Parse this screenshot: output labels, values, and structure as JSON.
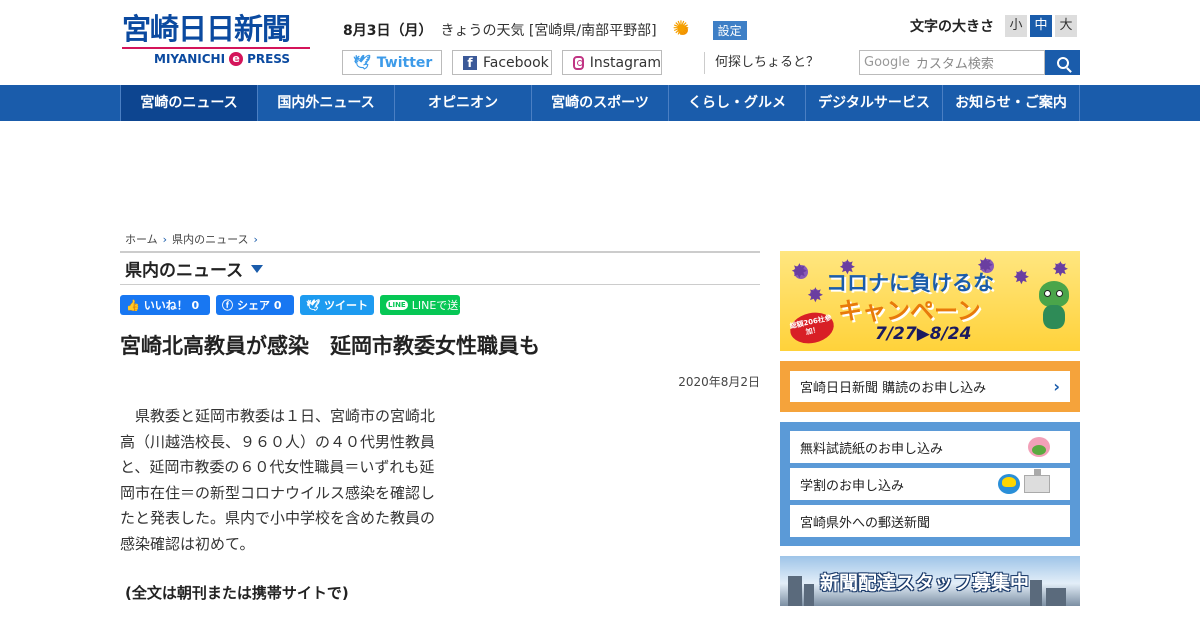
{
  "header": {
    "logo_main": "宮崎日日新聞",
    "logo_sub_left": "MIYANICHI",
    "logo_sub_e": "e",
    "logo_sub_right": "PRESS",
    "date": "8月3日（月）",
    "weather_label": "きょうの天気 [宮崎県/南部平野部]",
    "weather_icon": "sun-icon",
    "settings_label": "設定",
    "font_size_label": "文字の大きさ",
    "font_sizes": [
      "小",
      "中",
      "大"
    ],
    "font_size_selected": "中",
    "social": {
      "twitter": "Twitter",
      "facebook": "Facebook",
      "instagram": "Instagram"
    },
    "search_prompt": "何探しちょると？",
    "search_brand": "Google",
    "search_placeholder": "カスタム検索"
  },
  "nav": {
    "items": [
      "宮崎のニュース",
      "国内外ニュース",
      "オピニオン",
      "宮崎のスポーツ",
      "くらし・グルメ",
      "デジタルサービス",
      "お知らせ・ご案内"
    ],
    "active_index": 0
  },
  "breadcrumb": [
    "ホーム",
    "県内のニュース"
  ],
  "section_title": "県内のニュース",
  "share": {
    "like": "いいね！ 0",
    "share": "シェア 0",
    "tweet": "ツイート",
    "line": "LINEで送る",
    "line_badge": "LINE"
  },
  "article": {
    "title": "宮崎北高教員が感染　延岡市教委女性職員も",
    "date": "2020年8月2日",
    "body": "県教委と延岡市教委は１日、宮崎市の宮崎北高（川越浩校長、９６０人）の４０代男性教員と、延岡市教委の６０代女性職員＝いずれも延岡市在住＝の新型コロナウイルス感染を確認したと発表した。県内で小中学校を含めた教員の感染確認は初めて。",
    "note": "(全文は朝刊または携帯サイトで)"
  },
  "sidebar": {
    "corona_banner": {
      "line1": "コロナに負けるな",
      "line2": "キャンペーン",
      "dates": "7/27▶8/24",
      "badge": "総額206社参加！"
    },
    "subscribe": "宮崎日日新聞 購読のお申し込み",
    "links": [
      "無料試読紙のお申し込み",
      "学割のお申し込み",
      "宮崎県外への郵送新聞"
    ],
    "staff_banner": "新聞配達スタッフ募集中"
  },
  "colors": {
    "brand_blue": "#1a5cab",
    "accent_pink": "#d4145a",
    "subscribe_orange": "#f5a33b",
    "sidebar_blue": "#5b9ad7"
  }
}
